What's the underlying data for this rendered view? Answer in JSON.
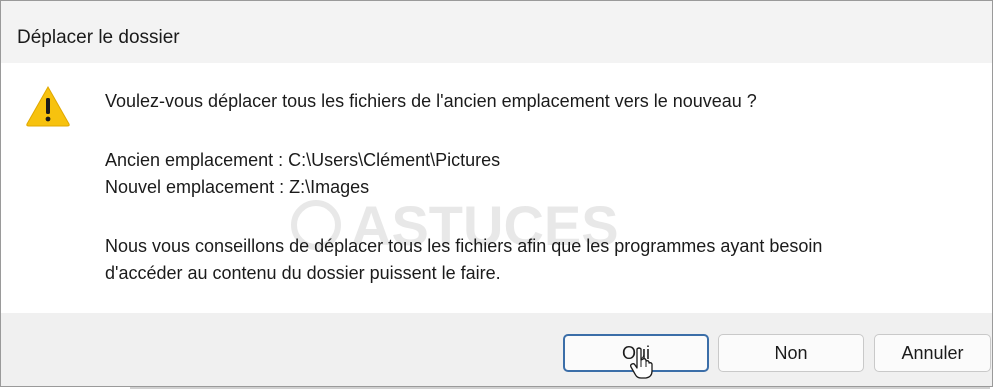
{
  "dialog": {
    "title": "Déplacer le dossier",
    "question": "Voulez-vous déplacer tous les fichiers de l'ancien emplacement vers le nouveau ?",
    "old_location": "Ancien emplacement : C:\\Users\\Clément\\Pictures",
    "new_location": "Nouvel emplacement : Z:\\Images",
    "advice_line1": "Nous vous conseillons de déplacer tous les fichiers afin que les programmes ayant besoin",
    "advice_line2": "d'accéder au contenu du dossier puissent le faire.",
    "icon": "warning-icon"
  },
  "buttons": {
    "yes_label": "Oui",
    "no_label": "Non",
    "cancel_label": "Annuler"
  },
  "watermark": {
    "text": "ASTUCES"
  },
  "colors": {
    "title_bar": "#f3f3f3",
    "footer": "#f0f0f0",
    "default_button_border": "#3b6ea8",
    "warning_yellow": "#f7c20e"
  }
}
